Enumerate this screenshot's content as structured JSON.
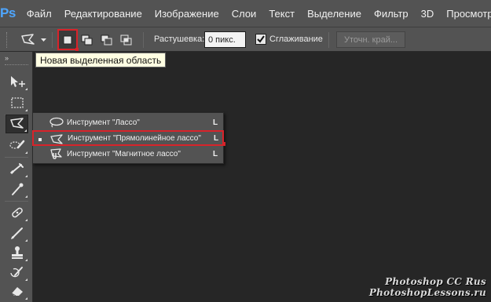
{
  "app": {
    "logo": "Ps"
  },
  "menu": [
    "Файл",
    "Редактирование",
    "Изображение",
    "Слои",
    "Текст",
    "Выделение",
    "Фильтр",
    "3D",
    "Просмотр"
  ],
  "options_bar": {
    "feather_label": "Растушевка:",
    "feather_value": "0 пикс.",
    "antialias_label": "Сглаживание",
    "antialias_checked": true,
    "refine_edge_label": "Уточн. край...",
    "selection_modes": [
      "new-selection",
      "add-to-selection",
      "subtract-from-selection",
      "intersect-selection"
    ],
    "active_mode": "new-selection"
  },
  "tooltip": {
    "text": "Новая выделенная область"
  },
  "flyout": {
    "items": [
      {
        "label": "Инструмент \"Лассо\"",
        "shortcut": "L",
        "icon": "lasso-icon",
        "selected": false
      },
      {
        "label": "Инструмент \"Прямолинейное лассо\"",
        "shortcut": "L",
        "icon": "polygonal-lasso-icon",
        "selected": true
      },
      {
        "label": "Инструмент \"Магнитное лассо\"",
        "shortcut": "L",
        "icon": "magnetic-lasso-icon",
        "selected": false
      }
    ]
  },
  "toolbar": {
    "collapse_label": "»",
    "tools": [
      "move-tool-icon",
      "marquee-tool-icon",
      "polygonal-lasso-tool-icon",
      "quick-selection-tool-icon",
      "crop-tool-icon",
      "eyedropper-tool-icon",
      "healing-brush-tool-icon",
      "brush-tool-icon",
      "clone-stamp-tool-icon",
      "history-brush-tool-icon",
      "eraser-tool-icon"
    ]
  },
  "watermark": {
    "line1": "Photoshop  CC  Rus",
    "line2": "PhotoshopLessons.ru"
  },
  "colors": {
    "accent_red": "#d8232a",
    "ps_blue": "#4ea6ff",
    "panel": "#535353",
    "canvas": "#262626"
  }
}
